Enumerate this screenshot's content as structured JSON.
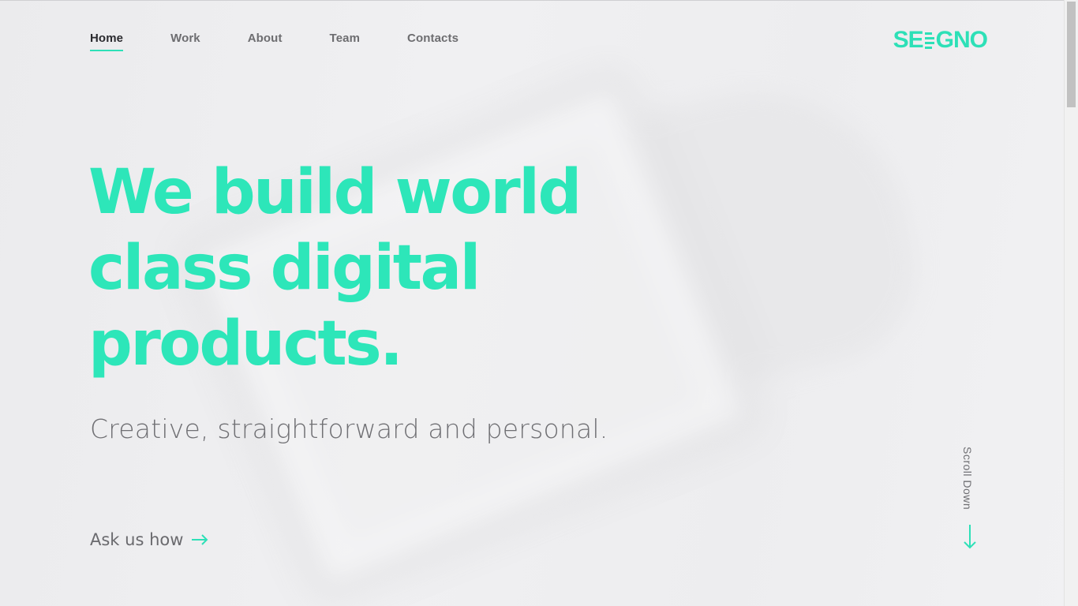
{
  "nav": {
    "items": [
      {
        "label": "Home",
        "active": true
      },
      {
        "label": "Work",
        "active": false
      },
      {
        "label": "About",
        "active": false
      },
      {
        "label": "Team",
        "active": false
      },
      {
        "label": "Contacts",
        "active": false
      }
    ]
  },
  "logo": {
    "left": "SE",
    "right": "GNO"
  },
  "hero": {
    "title_lines": [
      "We build world",
      "class digital",
      "products."
    ],
    "subtitle": "Creative, straightforward and personal.",
    "cta_label": "Ask us how",
    "cta_icon": "arrow-right-icon"
  },
  "scroll": {
    "label": "Scroll Down",
    "icon": "arrow-down-icon"
  },
  "colors": {
    "accent": "#2de0b7",
    "text_dark": "#2a2a2e",
    "text_muted": "#707074",
    "background": "#ececee"
  }
}
